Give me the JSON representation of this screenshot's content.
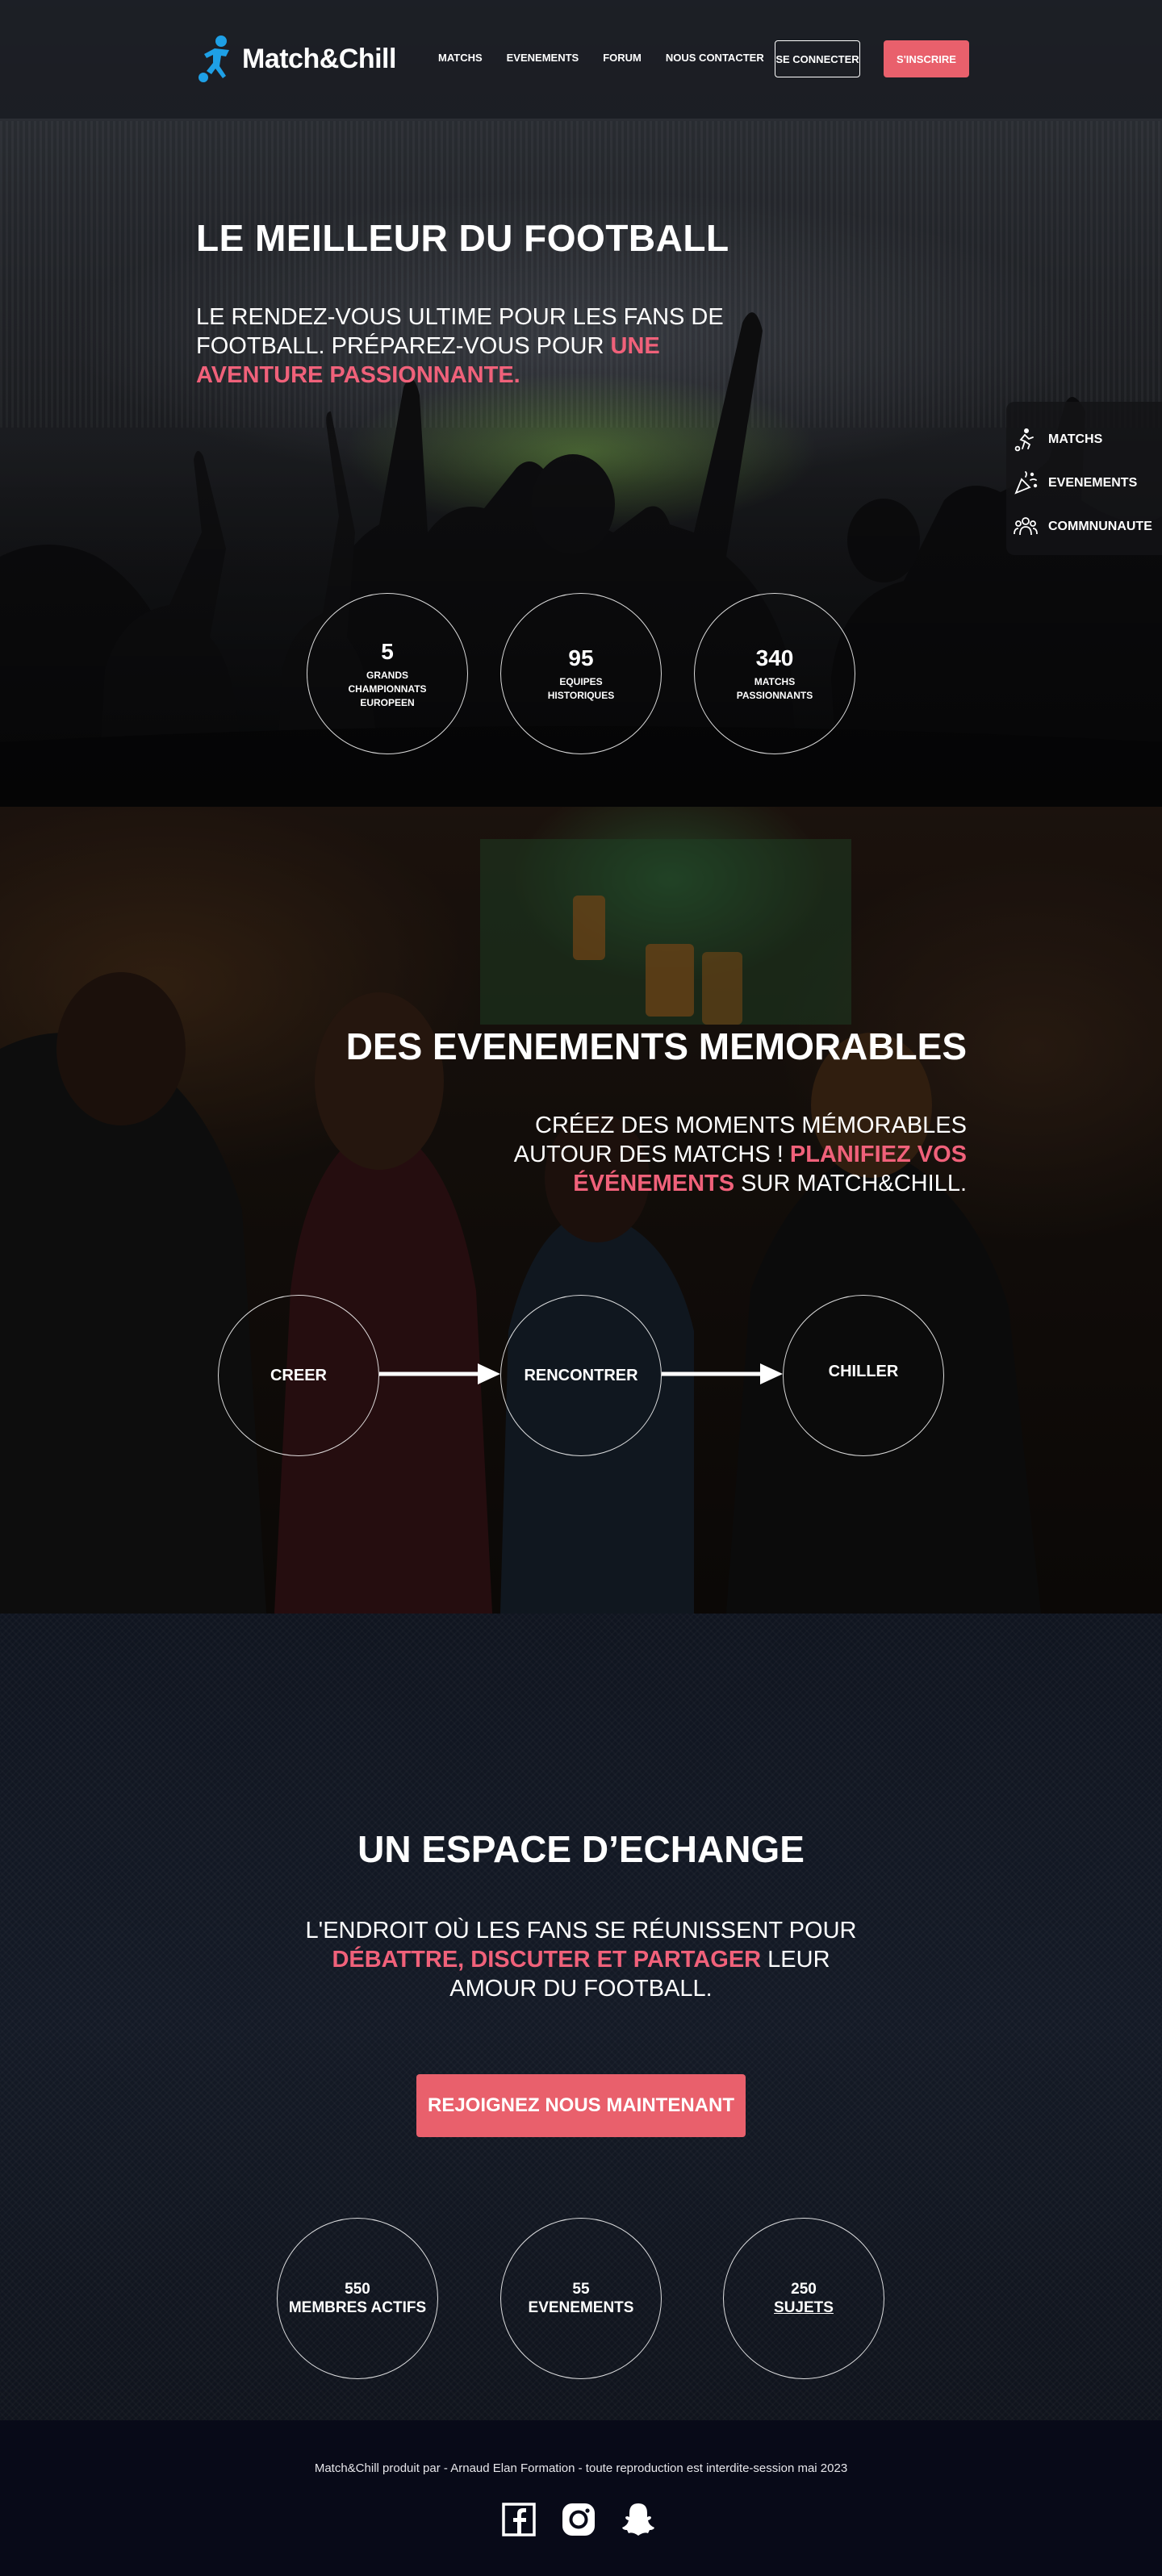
{
  "brand": {
    "name": "Match&Chill",
    "accent": "#e9606c",
    "logo_color": "#1ea0e6"
  },
  "nav": {
    "items": [
      {
        "label": "MATCHS"
      },
      {
        "label": "EVENEMENTS"
      },
      {
        "label": "FORUM"
      },
      {
        "label": "NOUS CONTACTER"
      }
    ],
    "login": "SE CONNECTER",
    "signup": "S'INSCRIRE"
  },
  "hero": {
    "title": "LE MEILLEUR DU FOOTBALL",
    "subtitle_plain": "LE RENDEZ-VOUS ULTIME POUR LES FANS DE FOOTBALL. PRÉPAREZ-VOUS POUR ",
    "subtitle_accent": "UNE AVENTURE PASSIONNANTE.",
    "stats": [
      {
        "value": "5",
        "label": "GRANDS CHAMPIONNATS EUROPEEN"
      },
      {
        "value": "95",
        "label": "EQUIPES HISTORIQUES"
      },
      {
        "value": "340",
        "label": "MATCHS PASSIONNANTS"
      }
    ]
  },
  "side_menu": {
    "items": [
      {
        "label": "MATCHS",
        "icon": "player-kick-icon"
      },
      {
        "label": "EVENEMENTS",
        "icon": "party-popper-icon"
      },
      {
        "label": "COMMNUNAUTE",
        "icon": "community-icon"
      }
    ]
  },
  "events": {
    "title": "DES EVENEMENTS MEMORABLES",
    "subtitle_plain": "CRÉEZ DES MOMENTS MÉMORABLES AUTOUR DES MATCHS ! ",
    "subtitle_accent": "PLANIFIEZ VOS ÉVÉNEMENTS",
    "subtitle_end": " SUR MATCH&CHILL.",
    "steps": [
      "CREER",
      "RENCONTRER",
      "CHILLER"
    ]
  },
  "community": {
    "title": "UN ESPACE D’ECHANGE",
    "subtitle_plain": "L'ENDROIT OÙ LES FANS SE RÉUNISSENT POUR ",
    "subtitle_accent": "DÉBATTRE, DISCUTER ET PARTAGER",
    "subtitle_end": " LEUR AMOUR DU FOOTBALL.",
    "cta": "REJOIGNEZ NOUS MAINTENANT",
    "stats": [
      {
        "value": "550",
        "label": "MEMBRES ACTIFS"
      },
      {
        "value": "55",
        "label": "EVENEMENTS"
      },
      {
        "value": "250",
        "label": "SUJETS"
      }
    ]
  },
  "footer": {
    "text": "Match&Chill  produit par - Arnaud Elan Formation - toute reproduction est interdite-session mai 2023",
    "socials": [
      "facebook-icon",
      "instagram-icon",
      "snapchat-icon"
    ]
  }
}
